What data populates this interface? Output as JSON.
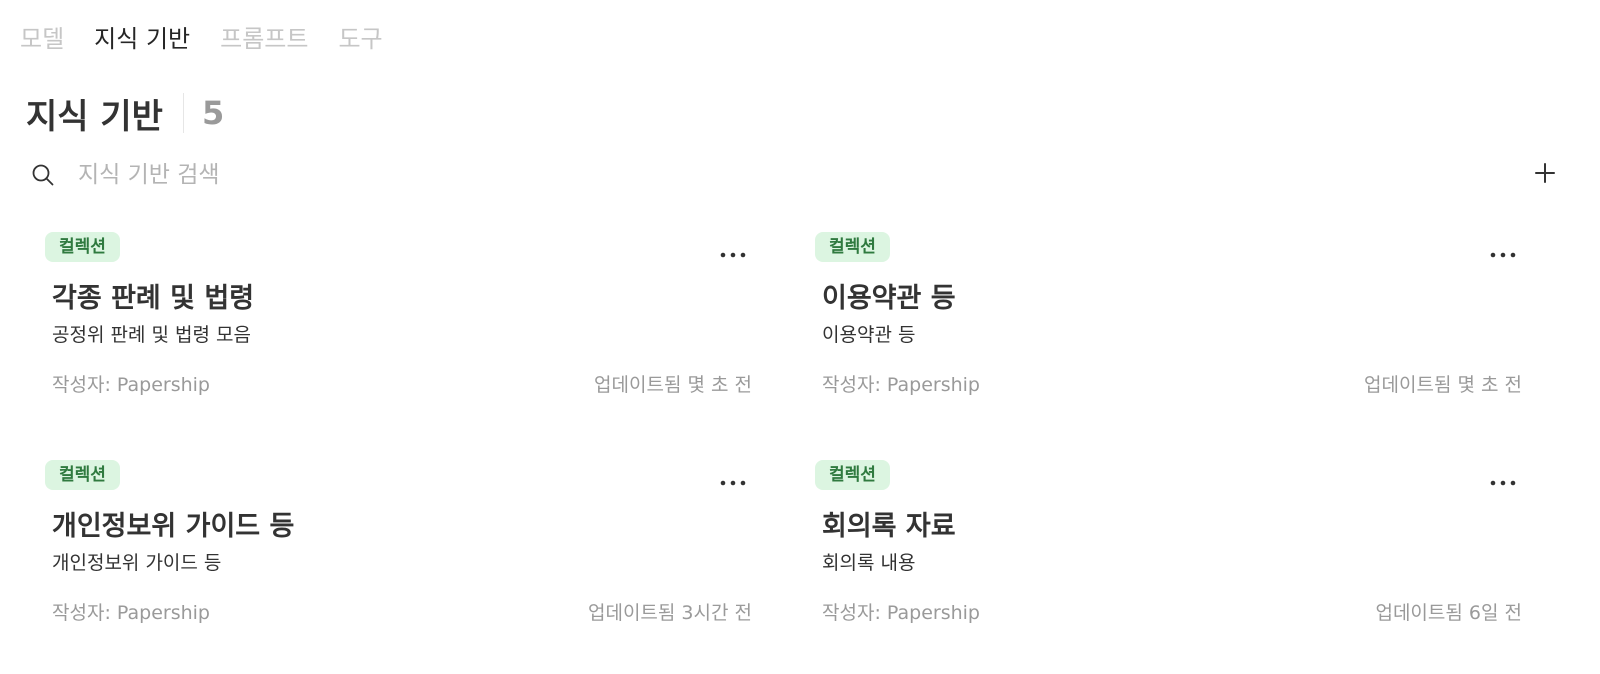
{
  "tabs": [
    {
      "label": "모델",
      "active": false
    },
    {
      "label": "지식 기반",
      "active": true
    },
    {
      "label": "프롬프트",
      "active": false
    },
    {
      "label": "도구",
      "active": false
    }
  ],
  "header": {
    "title": "지식 기반",
    "count": "5"
  },
  "search": {
    "placeholder": "지식 기반 검색",
    "value": "",
    "icon": "search-icon"
  },
  "add_button": {
    "icon": "plus-icon"
  },
  "cards": [
    {
      "badge": "컬렉션",
      "title": "각종 판례 및 법령",
      "description": "공정위 판례 및 법령 모음",
      "author": "작성자: Papership",
      "updated": "업데이트됨 몇 초 전"
    },
    {
      "badge": "컬렉션",
      "title": "이용약관 등",
      "description": "이용약관 등",
      "author": "작성자: Papership",
      "updated": "업데이트됨 몇 초 전"
    },
    {
      "badge": "컬렉션",
      "title": "개인정보위 가이드 등",
      "description": "개인정보위 가이드 등",
      "author": "작성자: Papership",
      "updated": "업데이트됨 3시간 전"
    },
    {
      "badge": "컬렉션",
      "title": "회의록 자료",
      "description": "회의록 내용",
      "author": "작성자: Papership",
      "updated": "업데이트됨 6일 전"
    }
  ],
  "colors": {
    "badge_bg": "#dcf5e1",
    "badge_text": "#2f7a3f",
    "active_tab": "#262626",
    "inactive_tab": "#c6c6c6"
  }
}
